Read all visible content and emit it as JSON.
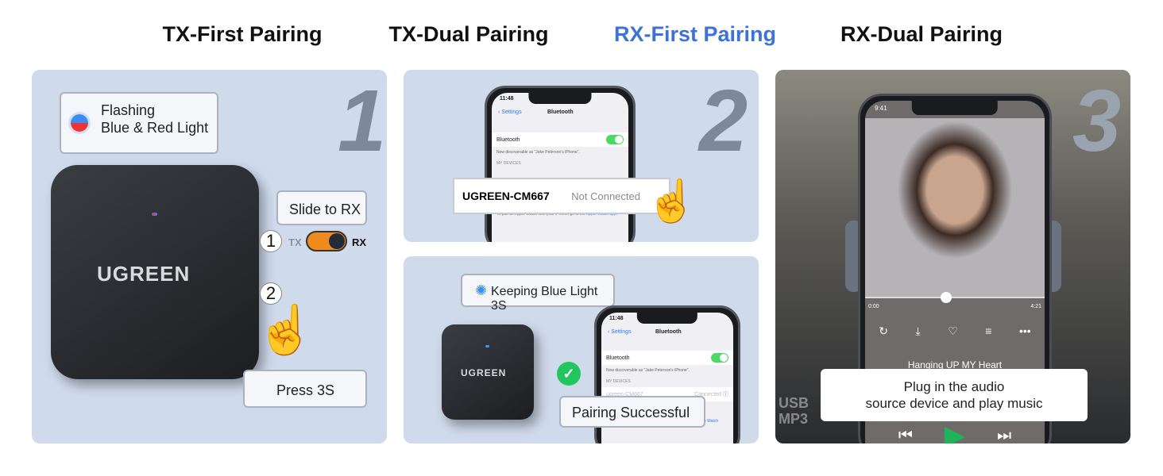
{
  "tabs": [
    {
      "label": "TX-First Pairing",
      "active": false
    },
    {
      "label": "TX-Dual Pairing",
      "active": false
    },
    {
      "label": "RX-First Pairing",
      "active": true
    },
    {
      "label": "RX-Dual Pairing",
      "active": false
    }
  ],
  "colors": {
    "accent": "#3d72d8",
    "panel_bg": "#cfdaeb",
    "switch_orange": "#f08a1c",
    "play_green": "#1db45a"
  },
  "step1": {
    "number": "1",
    "flash_line1": "Flashing",
    "flash_line2": "Blue & Red Light",
    "slide_label": "Slide to RX",
    "switch_tx": "TX",
    "switch_rx": "RX",
    "switch_position": "RX",
    "marker1": "1",
    "marker2": "2",
    "press_label": "Press 3S",
    "brand": "UGREEN"
  },
  "step2": {
    "number": "2",
    "phone": {
      "time": "11:48",
      "back": "Settings",
      "title": "Bluetooth",
      "bt_label": "Bluetooth",
      "discoverable": "Now discoverable as \"Jake Peterson's iPhone\".",
      "my_devices": "MY DEVICES",
      "pair_hint": "To pair an Apple Watch with your iPhone, go to the ",
      "pair_link": "Apple Watch app."
    },
    "device_name": "UGREEN-CM667",
    "device_status": "Not Connected",
    "keeping_label": "Keeping Blue Light 3S",
    "success_label": "Pairing Successful",
    "faded_device": "ugreen-CM667",
    "faded_status": "Connected",
    "brand": "UGREEN"
  },
  "step3": {
    "number": "3",
    "time": "9:41",
    "elapsed": "0:00",
    "duration": "4:21",
    "progress_fraction": 0.45,
    "song": "Hanging UP MY Heart",
    "caption_line1": "Plug in the audio",
    "caption_line2": "source device and play music",
    "car_text": "USB MP3"
  }
}
